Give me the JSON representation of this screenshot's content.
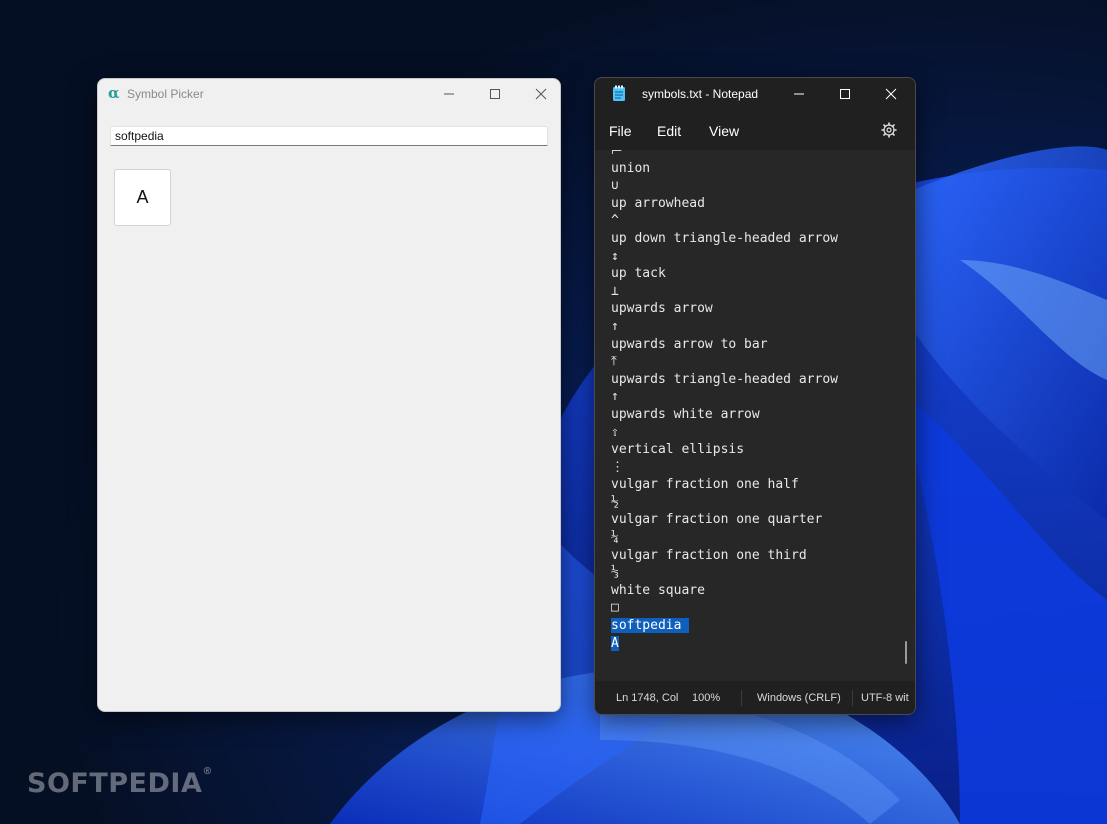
{
  "desktop": {
    "accent": "#0a3cd6",
    "background": "#071530"
  },
  "symbol_picker": {
    "title": "Symbol Picker",
    "logo_glyph": "α",
    "search_value": "softpedia",
    "results": [
      "A"
    ]
  },
  "notepad": {
    "title": "symbols.txt - Notepad",
    "menu": [
      "File",
      "Edit",
      "View"
    ],
    "lines": [
      "⊨",
      "union",
      "∪",
      "up arrowhead",
      "^",
      "up down triangle-headed arrow",
      "↕",
      "up tack",
      "⊥",
      "upwards arrow",
      "↑",
      "upwards arrow to bar",
      "⤒",
      "upwards triangle-headed arrow",
      "↑",
      "upwards white arrow",
      "⇧",
      "vertical ellipsis",
      "⋮",
      "vulgar fraction one half",
      "½",
      "vulgar fraction one quarter",
      "¼",
      "vulgar fraction one third",
      "⅓",
      "white square",
      "□",
      "softpedia ",
      "A"
    ],
    "selected_lines": [
      27,
      28
    ],
    "status": {
      "position": "Ln 1748, Col",
      "zoom": "100%",
      "line_ending": "Windows (CRLF)",
      "encoding": "UTF-8 wit"
    }
  },
  "watermark": {
    "text": "SOFTPEDIA",
    "mark": "®"
  }
}
